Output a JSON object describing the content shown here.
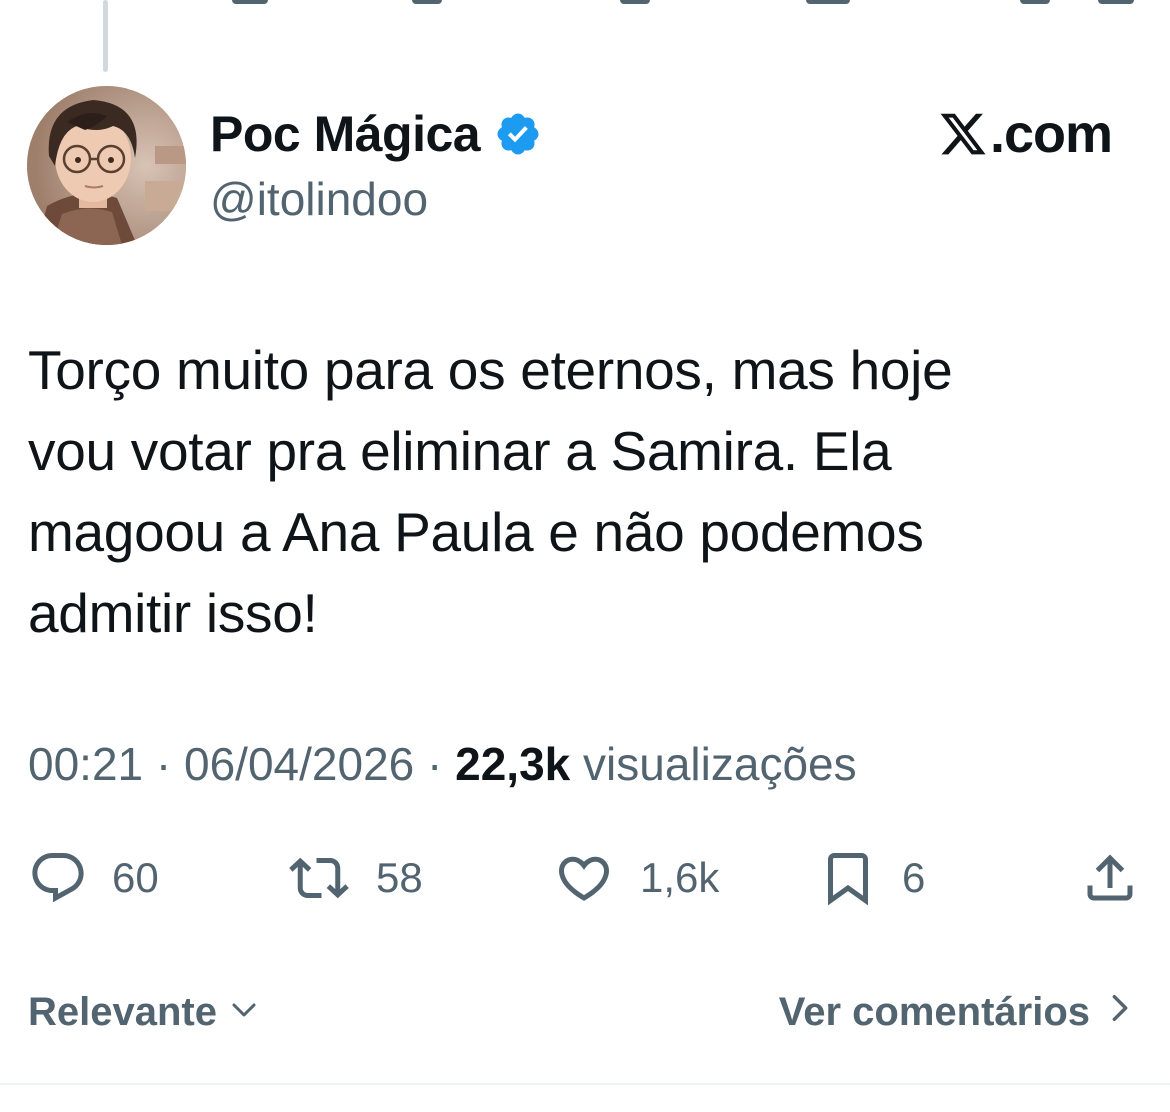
{
  "author": {
    "display_name": "Poc Mágica",
    "handle": "@itolindoo",
    "verified": true
  },
  "brand": {
    "label": ".com"
  },
  "tweet": {
    "text": "Torço muito para os eternos, mas hoje\nvou votar pra eliminar a Samira. Ela\nmagoou a Ana Paula e não podemos\nadmitir isso!",
    "time": "00:21",
    "separator": " · ",
    "date": "06/04/2026",
    "views_count": "22,3k",
    "views_label": "visualizações"
  },
  "actions": {
    "replies": "60",
    "reposts": "58",
    "likes": "1,6k",
    "bookmarks": "6"
  },
  "footer": {
    "sort_label": "Relevante",
    "view_comments_label": "Ver comentários"
  },
  "colors": {
    "text_primary": "#0f1419",
    "text_secondary": "#536471",
    "verified_blue": "#1d9bf0",
    "divider": "#eff3f4"
  },
  "icons": {
    "reply": "speech-bubble-icon",
    "repost": "repost-arrows-icon",
    "like": "heart-icon",
    "bookmark": "bookmark-icon",
    "share": "share-upload-icon",
    "sort": "chevron-down-icon",
    "view_comments": "chevron-right-icon"
  }
}
